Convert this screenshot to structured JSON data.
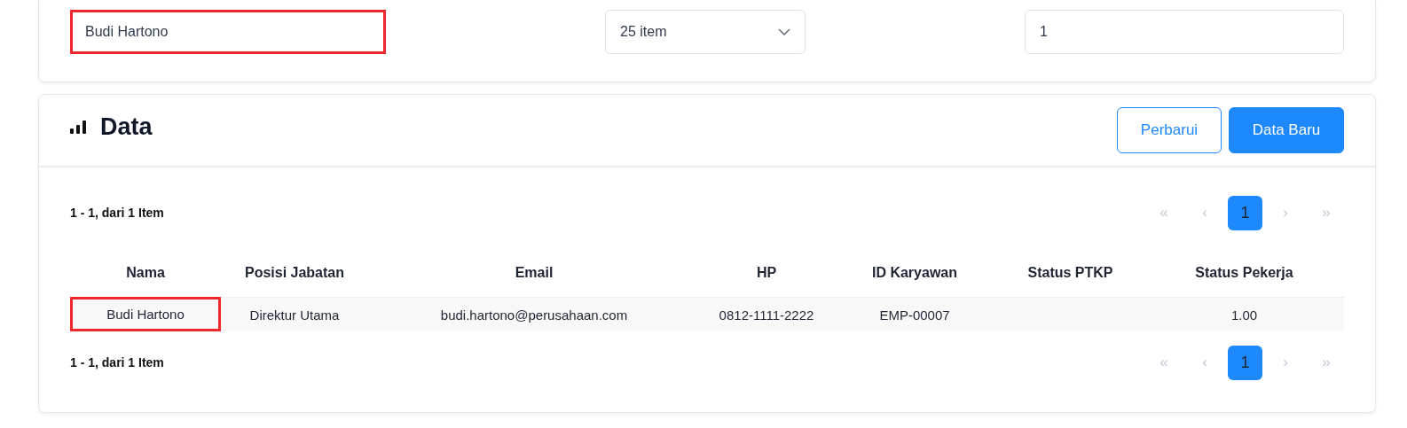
{
  "filters": {
    "search": {
      "value": "Budi Hartono",
      "highlighted": true
    },
    "page_size": {
      "value": "25 item"
    },
    "page_number": {
      "value": "1"
    }
  },
  "data_panel": {
    "title": "Data",
    "buttons": [
      {
        "label": "Perbarui",
        "kind": "outline"
      },
      {
        "label": "Data Baru",
        "kind": "primary"
      }
    ],
    "summary_top": "1 - 1, dari 1 Item",
    "pager_top": [
      {
        "label": "«",
        "selected": false,
        "disabled": true
      },
      {
        "label": "‹",
        "selected": false,
        "disabled": true
      },
      {
        "label": "1",
        "selected": true,
        "disabled": false
      },
      {
        "label": "›",
        "selected": false,
        "disabled": true
      },
      {
        "label": "»",
        "selected": false,
        "disabled": true
      }
    ],
    "table": {
      "columns": [
        "Nama",
        "Posisi Jabatan",
        "Email",
        "HP",
        "ID Karyawan",
        "Status PTKP",
        "Status Pekerja"
      ],
      "rows": [
        {
          "cells": [
            {
              "text": "Budi Hartono",
              "highlighted": true
            },
            {
              "text": "Direktur Utama",
              "highlighted": false
            },
            {
              "text": "budi.hartono@perusahaan.com",
              "highlighted": false
            },
            {
              "text": "0812-1111-2222",
              "highlighted": false
            },
            {
              "text": "EMP-00007",
              "highlighted": false
            },
            null,
            {
              "text": "1.00",
              "highlighted": false
            }
          ]
        }
      ]
    },
    "summary_bottom": "1 - 1, dari 1 Item",
    "pager_bottom": [
      {
        "label": "«",
        "selected": false,
        "disabled": true
      },
      {
        "label": "‹",
        "selected": false,
        "disabled": true
      },
      {
        "label": "1",
        "selected": true,
        "disabled": false
      },
      {
        "label": "›",
        "selected": false,
        "disabled": true
      },
      {
        "label": "»",
        "selected": false,
        "disabled": true
      }
    ]
  }
}
